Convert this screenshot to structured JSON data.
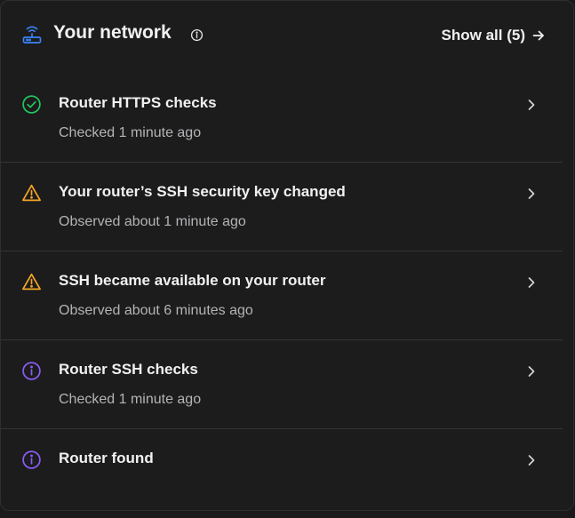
{
  "header": {
    "title": "Your network",
    "show_all_label": "Show all (5)"
  },
  "colors": {
    "accent_blue": "#3b82f6",
    "success_green": "#22c55e",
    "warning_amber": "#f5a524",
    "info_purple": "#8b5cf6",
    "text_primary": "#f1f1f1",
    "text_secondary": "#b4b4b6"
  },
  "items": [
    {
      "icon": "check-circle-icon",
      "title": "Router HTTPS checks",
      "subtitle": "Checked 1 minute ago"
    },
    {
      "icon": "warning-triangle-icon",
      "title": "Your router’s SSH security key changed",
      "subtitle": "Observed about 1 minute ago"
    },
    {
      "icon": "warning-triangle-icon",
      "title": "SSH became available on your router",
      "subtitle": "Observed about 6 minutes ago"
    },
    {
      "icon": "info-circle-icon",
      "title": "Router SSH checks",
      "subtitle": "Checked 1 minute ago"
    },
    {
      "icon": "info-circle-icon",
      "title": "Router found",
      "subtitle": ""
    }
  ]
}
